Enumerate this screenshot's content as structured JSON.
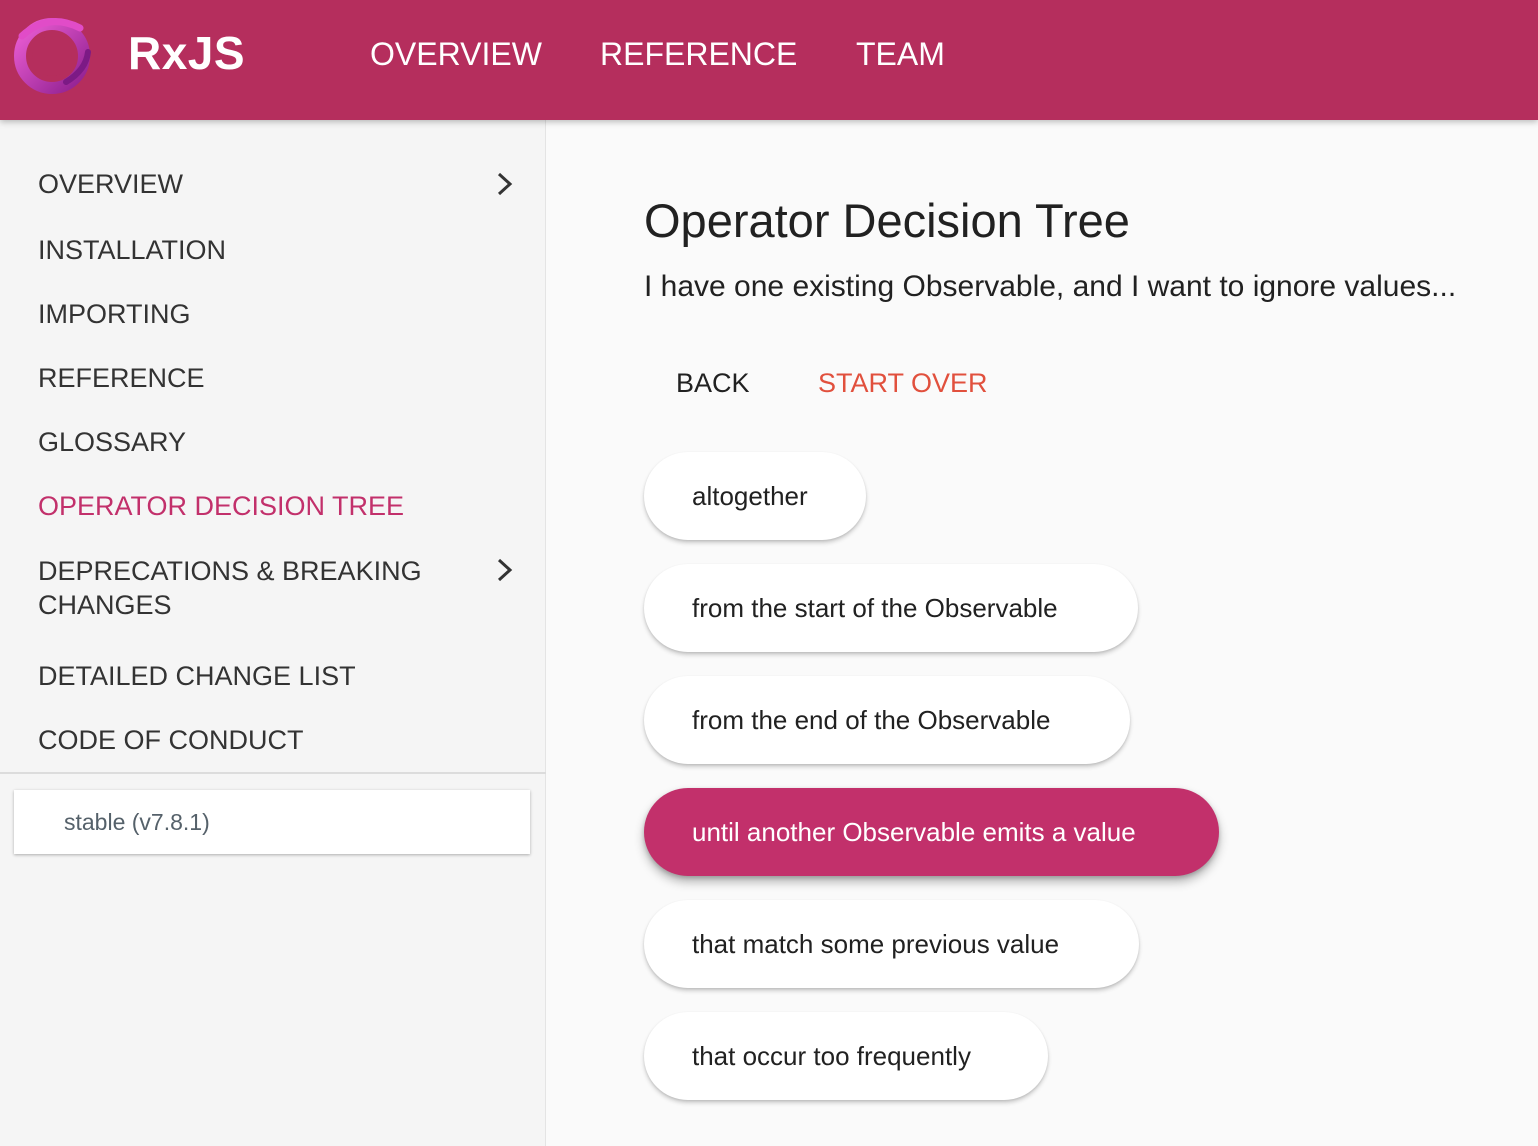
{
  "header": {
    "brand": "RxJS",
    "logo_icon": "rxjs-logo-icon",
    "nav": [
      "OVERVIEW",
      "REFERENCE",
      "TEAM"
    ]
  },
  "sidebar": {
    "items": [
      {
        "label": "OVERVIEW",
        "expandable": true
      },
      {
        "label": "INSTALLATION"
      },
      {
        "label": "IMPORTING"
      },
      {
        "label": "REFERENCE"
      },
      {
        "label": "GLOSSARY"
      },
      {
        "label": "OPERATOR DECISION TREE",
        "active": true
      },
      {
        "label": "DEPRECATIONS & BREAKING CHANGES",
        "expandable": true
      },
      {
        "label": "DETAILED CHANGE LIST"
      },
      {
        "label": "CODE OF CONDUCT"
      }
    ],
    "version": "stable (v7.8.1)"
  },
  "main": {
    "title": "Operator Decision Tree",
    "subtitle": "I have one existing Observable, and I want to ignore values...",
    "back_label": "BACK",
    "start_over_label": "START OVER",
    "options": [
      {
        "label": "altogether"
      },
      {
        "label": "from the start of the Observable"
      },
      {
        "label": "from the end of the Observable"
      },
      {
        "label": "until another Observable emits a value",
        "selected": true
      },
      {
        "label": "that match some previous value"
      },
      {
        "label": "that occur too frequently"
      }
    ]
  },
  "colors": {
    "brand": "#b52e5d",
    "accent": "#c2306b",
    "start_over": "#e1503d"
  }
}
